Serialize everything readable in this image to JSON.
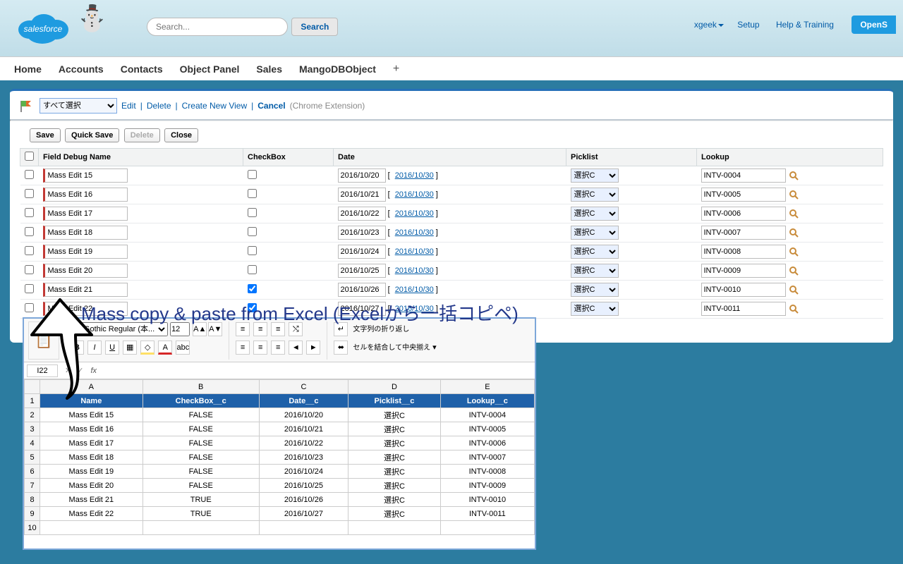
{
  "header": {
    "logo_text": "salesforce",
    "search_placeholder": "Search...",
    "search_button": "Search",
    "user": "xgeek",
    "setup": "Setup",
    "help": "Help & Training",
    "open": "OpenS"
  },
  "tabs": [
    "Home",
    "Accounts",
    "Contacts",
    "Object Panel",
    "Sales",
    "MangoDBObject"
  ],
  "list": {
    "view_selected": "すべて選択",
    "edit": "Edit",
    "delete": "Delete",
    "create": "Create New View",
    "cancel": "Cancel",
    "ext_note": "(Chrome Extension)"
  },
  "buttons": {
    "save": "Save",
    "quick_save": "Quick Save",
    "delete": "Delete",
    "close": "Close"
  },
  "columns": {
    "name": "Field Debug Name",
    "checkbox": "CheckBox",
    "date": "Date",
    "picklist": "Picklist",
    "lookup": "Lookup"
  },
  "rows": [
    {
      "name": "Mass Edit 15",
      "checkbox": false,
      "date": "2016/10/20",
      "date_link": "2016/10/30",
      "picklist": "選択C",
      "lookup": "INTV-0004"
    },
    {
      "name": "Mass Edit 16",
      "checkbox": false,
      "date": "2016/10/21",
      "date_link": "2016/10/30",
      "picklist": "選択C",
      "lookup": "INTV-0005"
    },
    {
      "name": "Mass Edit 17",
      "checkbox": false,
      "date": "2016/10/22",
      "date_link": "2016/10/30",
      "picklist": "選択C",
      "lookup": "INTV-0006"
    },
    {
      "name": "Mass Edit 18",
      "checkbox": false,
      "date": "2016/10/23",
      "date_link": "2016/10/30",
      "picklist": "選択C",
      "lookup": "INTV-0007"
    },
    {
      "name": "Mass Edit 19",
      "checkbox": false,
      "date": "2016/10/24",
      "date_link": "2016/10/30",
      "picklist": "選択C",
      "lookup": "INTV-0008"
    },
    {
      "name": "Mass Edit 20",
      "checkbox": false,
      "date": "2016/10/25",
      "date_link": "2016/10/30",
      "picklist": "選択C",
      "lookup": "INTV-0009"
    },
    {
      "name": "Mass Edit 21",
      "checkbox": true,
      "date": "2016/10/26",
      "date_link": "2016/10/30",
      "picklist": "選択C",
      "lookup": "INTV-0010"
    },
    {
      "name": "Mass Edit 22",
      "checkbox": true,
      "date": "2016/10/27",
      "date_link": "2016/10/30",
      "picklist": "選択C",
      "lookup": "INTV-0011"
    }
  ],
  "annotation": "Mass copy & paste from Excel (Excelから一括コピペ)",
  "excel": {
    "font_name": "Yu Gothic Regular (本...",
    "font_size": "12",
    "wrap_label": "文字列の折り返し",
    "merge_label": "セルを結合して中央揃え",
    "cell_ref": "I22",
    "cols": [
      "A",
      "B",
      "C",
      "D",
      "E"
    ],
    "headers": [
      "Name",
      "CheckBox__c",
      "Date__c",
      "Picklist__c",
      "Lookup__c"
    ],
    "data": [
      [
        "Mass Edit 15",
        "FALSE",
        "2016/10/20",
        "選択C",
        "INTV-0004"
      ],
      [
        "Mass Edit 16",
        "FALSE",
        "2016/10/21",
        "選択C",
        "INTV-0005"
      ],
      [
        "Mass Edit 17",
        "FALSE",
        "2016/10/22",
        "選択C",
        "INTV-0006"
      ],
      [
        "Mass Edit 18",
        "FALSE",
        "2016/10/23",
        "選択C",
        "INTV-0007"
      ],
      [
        "Mass Edit 19",
        "FALSE",
        "2016/10/24",
        "選択C",
        "INTV-0008"
      ],
      [
        "Mass Edit 20",
        "FALSE",
        "2016/10/25",
        "選択C",
        "INTV-0009"
      ],
      [
        "Mass Edit 21",
        "TRUE",
        "2016/10/26",
        "選択C",
        "INTV-0010"
      ],
      [
        "Mass Edit 22",
        "TRUE",
        "2016/10/27",
        "選択C",
        "INTV-0011"
      ]
    ]
  }
}
